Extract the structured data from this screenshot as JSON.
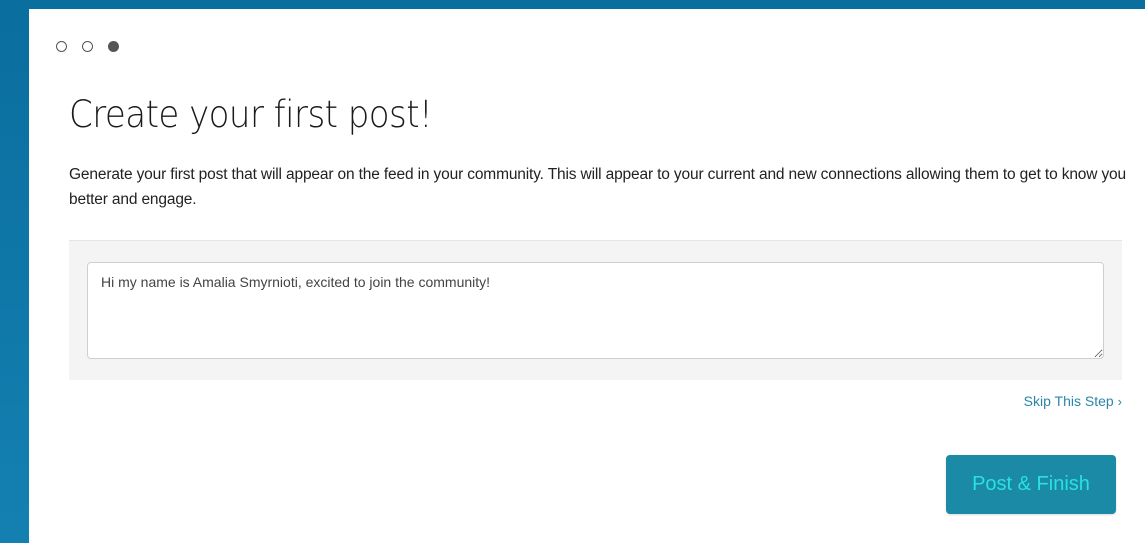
{
  "steps": [
    {
      "state": "complete"
    },
    {
      "state": "complete"
    },
    {
      "state": "current"
    }
  ],
  "page": {
    "title": "Create your first post!",
    "description": "Generate your first post that will appear on the feed in your community. This will appear to your current and new connections allowing them to get to know you better and engage."
  },
  "post": {
    "value": "Hi my name is Amalia Smyrnioti, excited to join the community!"
  },
  "actions": {
    "skip_label": "Skip This Step",
    "skip_icon": "chevron-right-icon",
    "finish_label": "Post & Finish"
  },
  "colors": {
    "background": "#0a6e9e",
    "accent": "#1a8aa6",
    "button_text": "#29e1e1",
    "link": "#2a86a8"
  }
}
